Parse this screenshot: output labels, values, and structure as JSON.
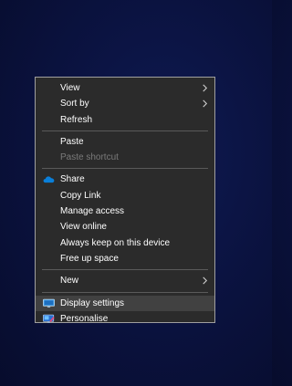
{
  "context_menu": {
    "group1": [
      {
        "label": "View",
        "submenu": true,
        "icon": null
      },
      {
        "label": "Sort by",
        "submenu": true,
        "icon": null
      },
      {
        "label": "Refresh",
        "submenu": false,
        "icon": null
      }
    ],
    "group2": [
      {
        "label": "Paste",
        "disabled": false
      },
      {
        "label": "Paste shortcut",
        "disabled": true
      }
    ],
    "group3": [
      {
        "label": "Share",
        "icon": "onedrive-cloud-icon"
      },
      {
        "label": "Copy Link"
      },
      {
        "label": "Manage access"
      },
      {
        "label": "View online"
      },
      {
        "label": "Always keep on this device"
      },
      {
        "label": "Free up space"
      }
    ],
    "group4": [
      {
        "label": "New",
        "submenu": true
      }
    ],
    "group5": [
      {
        "label": "Display settings",
        "icon": "display-monitor-icon",
        "highlighted": true
      },
      {
        "label": "Personalise",
        "icon": "personalise-icon"
      }
    ]
  },
  "colors": {
    "desktop_bg": "#0b1341",
    "menu_bg": "#2b2b2b",
    "menu_border": "#a0a0a0",
    "text": "#ffffff",
    "disabled_text": "#7a7a7a",
    "highlight": "#414141",
    "onedrive_blue": "#0a7fd9"
  }
}
